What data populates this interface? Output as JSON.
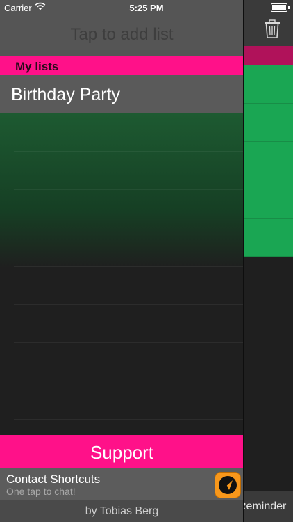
{
  "status_bar": {
    "carrier": "Carrier",
    "time": "5:25 PM",
    "battery_level": 1.0
  },
  "sidebar": {
    "add_placeholder": "Tap to add list",
    "section_title": "My lists",
    "lists": [
      "Birthday Party"
    ],
    "support_label": "Support",
    "contact": {
      "title": "Contact Shortcuts",
      "subtitle": "One tap to chat!"
    },
    "footer": "by Tobias Berg"
  },
  "main": {
    "bottom_label": "Reminder",
    "trash_icon": "trash-icon"
  },
  "colors": {
    "accent": "#ff1189",
    "green": "#1aa653",
    "background": "#1f1f1f"
  }
}
